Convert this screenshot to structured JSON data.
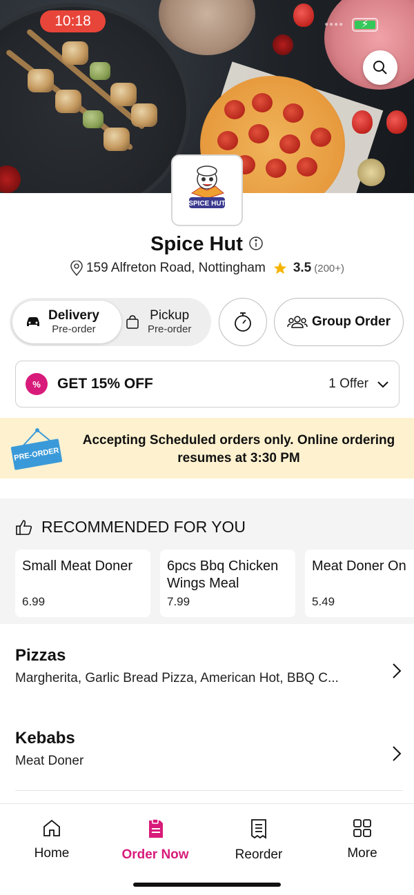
{
  "status_bar": {
    "time": "10:18"
  },
  "restaurant": {
    "name": "Spice Hut",
    "logo_text": "SPICE HUT",
    "address": "159 Alfreton Road, Nottingham",
    "rating": "3.5",
    "rating_count": "(200+)"
  },
  "order_mode": {
    "delivery": {
      "label": "Delivery",
      "sub": "Pre-order"
    },
    "pickup": {
      "label": "Pickup",
      "sub": "Pre-order"
    }
  },
  "group_order_label": "Group Order",
  "offer": {
    "title": "GET 15% OFF",
    "count": "1 Offer",
    "badge": "%"
  },
  "banner": {
    "sign_text": "PRE-ORDER",
    "message": "Accepting Scheduled orders only. Online ordering resumes at 3:30 PM"
  },
  "recommended": {
    "title": "RECOMMENDED FOR YOU",
    "items": [
      {
        "name": "Small Meat Doner",
        "price": "6.99"
      },
      {
        "name": "6pcs Bbq Chicken Wings Meal",
        "price": "7.99"
      },
      {
        "name": "Meat Doner On Tray",
        "price": "5.49"
      }
    ]
  },
  "categories": [
    {
      "name": "Pizzas",
      "items": "Margherita, Garlic Bread Pizza, American Hot, BBQ C..."
    },
    {
      "name": "Kebabs",
      "items": "Meat Doner"
    }
  ],
  "nav": {
    "items": [
      {
        "label": "Home",
        "icon": "home-icon"
      },
      {
        "label": "Order Now",
        "icon": "order-icon"
      },
      {
        "label": "Reorder",
        "icon": "receipt-icon"
      },
      {
        "label": "More",
        "icon": "grid-icon"
      }
    ],
    "active": "Order Now"
  },
  "colors": {
    "accent": "#d81b7a",
    "banner_bg": "#fdf1cf",
    "star": "#f5b400",
    "status_pill": "#e8453a"
  }
}
